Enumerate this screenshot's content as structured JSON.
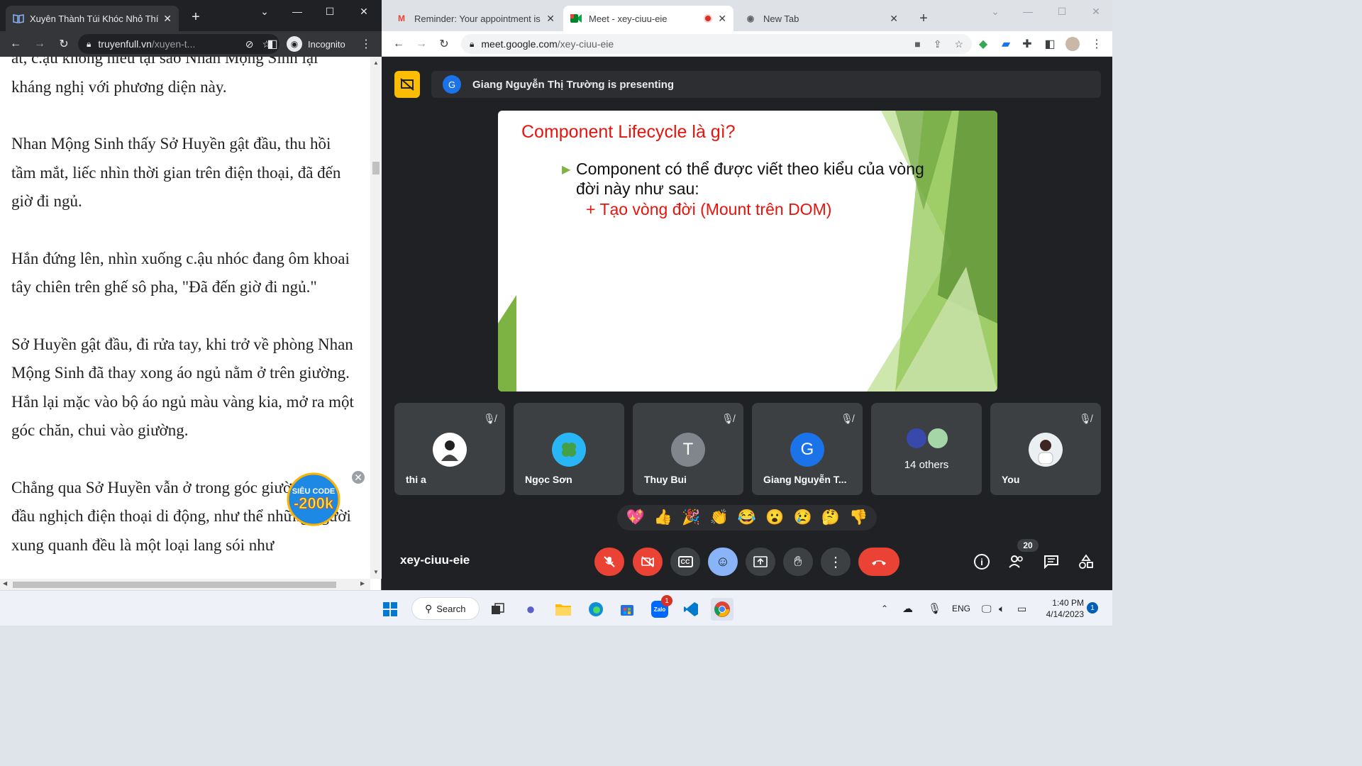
{
  "left_browser": {
    "tab_title": "Xuyên Thành Túi Khóc Nhỏ Thích",
    "url_host": "truyenfull.vn",
    "url_path": "/xuyen-t...",
    "incognito_label": "Incognito"
  },
  "reader": {
    "paragraphs": [
      "ất, c.ậu không hiểu tại sao Nhan Mộng Sinh lại kháng nghị với phương diện này.",
      "Nhan Mộng Sinh thấy Sở Huyền gật đầu, thu hồi tầm mắt, liếc nhìn thời gian trên điện thoại, đã đến giờ đi ngủ.",
      "Hắn đứng lên, nhìn xuống c.ậu nhóc đang ôm khoai tây chiên trên ghế sô pha, \"Đã đến giờ đi ngủ.\"",
      "Sở Huyền gật đầu, đi rửa tay, khi trở về phòng Nhan Mộng Sinh đã thay xong áo ngủ nằm ở trên giường. Hắn lại mặc vào bộ áo ngủ màu vàng kia, mở ra một góc chăn, chui vào giường.",
      "Chẳng qua Sở Huyền vẫn ở trong góc giường cúi đầu nghịch điện thoại di động, như thể những người xung quanh đều là một loại lang sói như"
    ],
    "promo_line1": "SIÊU CODE",
    "promo_line2": "-200k"
  },
  "right_browser": {
    "tabs": [
      {
        "title": "Reminder: Your appointment is c"
      },
      {
        "title": "Meet - xey-ciuu-eie"
      },
      {
        "title": "New Tab"
      }
    ],
    "url_host": "meet.google.com",
    "url_path": "/xey-ciuu-eie"
  },
  "meet": {
    "presenter_initial": "G",
    "presenting_text": "Giang Nguyễn Thị Trường is presenting",
    "slide": {
      "title": "Component Lifecycle là gì?",
      "bullet": "Component có thể được viết theo kiểu của vòng đời này như sau:",
      "sub": "+ Tạo vòng đời (Mount trên DOM)"
    },
    "participants": [
      {
        "name": "thi a",
        "initial": ""
      },
      {
        "name": "Ngọc Sơn",
        "initial": ""
      },
      {
        "name": "Thuy Bui",
        "initial": "T"
      },
      {
        "name": "Giang Nguyễn T...",
        "initial": "G"
      },
      {
        "name": "14 others",
        "initial": ""
      },
      {
        "name": "You",
        "initial": ""
      }
    ],
    "reactions": [
      "💖",
      "👍",
      "🎉",
      "👏",
      "😂",
      "😮",
      "😢",
      "🤔",
      "👎"
    ],
    "meeting_code": "xey-ciuu-eie",
    "people_count": "20",
    "colors": {
      "accent": "#fbbc04",
      "danger": "#ea4335",
      "avatar_blue": "#1a73e8",
      "tile_bg": "#3c4043"
    }
  },
  "taskbar": {
    "search_label": "Search",
    "zalo_badge": "1",
    "lang": "ENG",
    "time": "1:40 PM",
    "date": "4/14/2023",
    "notification_count": "1"
  }
}
